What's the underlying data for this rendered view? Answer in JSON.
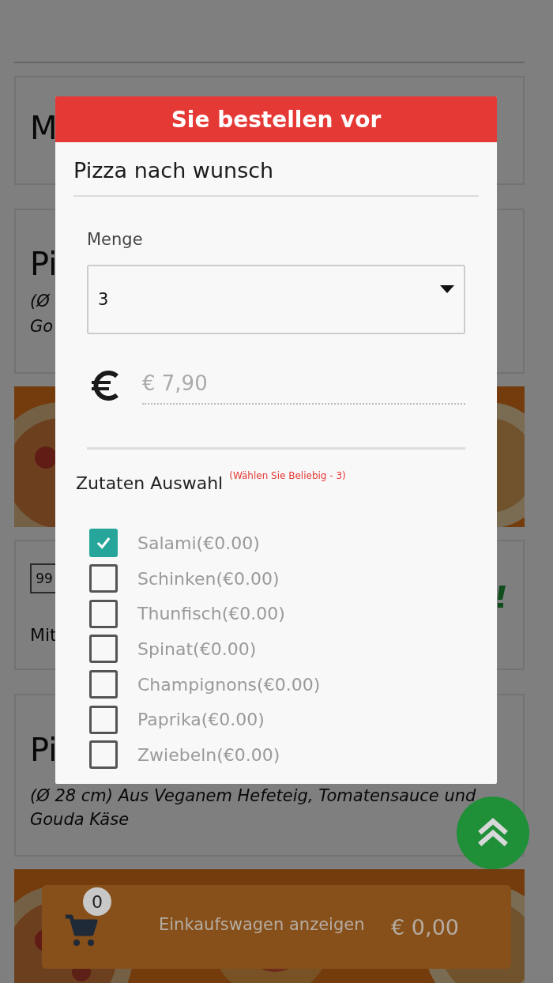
{
  "background_page": {
    "sections": [
      {
        "kind": "card",
        "items": [
          {
            "kind": "title",
            "text": "M"
          }
        ]
      },
      {
        "kind": "card",
        "items": [
          {
            "kind": "title",
            "text": "Pi"
          },
          {
            "kind": "italic",
            "text": "(Ø"
          },
          {
            "kind": "italic",
            "text": "Go"
          }
        ]
      },
      {
        "kind": "picture"
      },
      {
        "kind": "card",
        "items": [
          {
            "kind": "input",
            "text": "99"
          },
          {
            "kind": "status_icon"
          },
          {
            "kind": "text",
            "text": "Mit"
          }
        ]
      },
      {
        "kind": "card",
        "items": [
          {
            "kind": "title",
            "text": "Pi"
          },
          {
            "kind": "italic",
            "text": "(Ø 28 cm) Aus Veganem Hefeteig, Tomatensauce und"
          },
          {
            "kind": "italic",
            "text": "Gouda Käse"
          }
        ]
      },
      {
        "kind": "picture"
      }
    ]
  },
  "dialog": {
    "header": "Sie bestellen vor",
    "title": "Pizza nach wunsch",
    "quantity": {
      "label": "Menge",
      "value": "3"
    },
    "price": {
      "value": "€ 7,90"
    },
    "toppings": {
      "label": "Zutaten Auswahl",
      "hint": "(Wählen Sie Beliebig - 3)",
      "items": [
        {
          "label": "Salami(€0.00)",
          "checked": true
        },
        {
          "label": "Schinken(€0.00)",
          "checked": false
        },
        {
          "label": "Thunfisch(€0.00)",
          "checked": false
        },
        {
          "label": "Spinat(€0.00)",
          "checked": false
        },
        {
          "label": "Champignons(€0.00)",
          "checked": false
        },
        {
          "label": "Paprika(€0.00)",
          "checked": false
        },
        {
          "label": "Zwiebeln(€0.00)",
          "checked": false
        }
      ]
    }
  },
  "cart_bar": {
    "count": "0",
    "label": "Einkaufswagen anzeigen",
    "total": "€ 0,00"
  }
}
